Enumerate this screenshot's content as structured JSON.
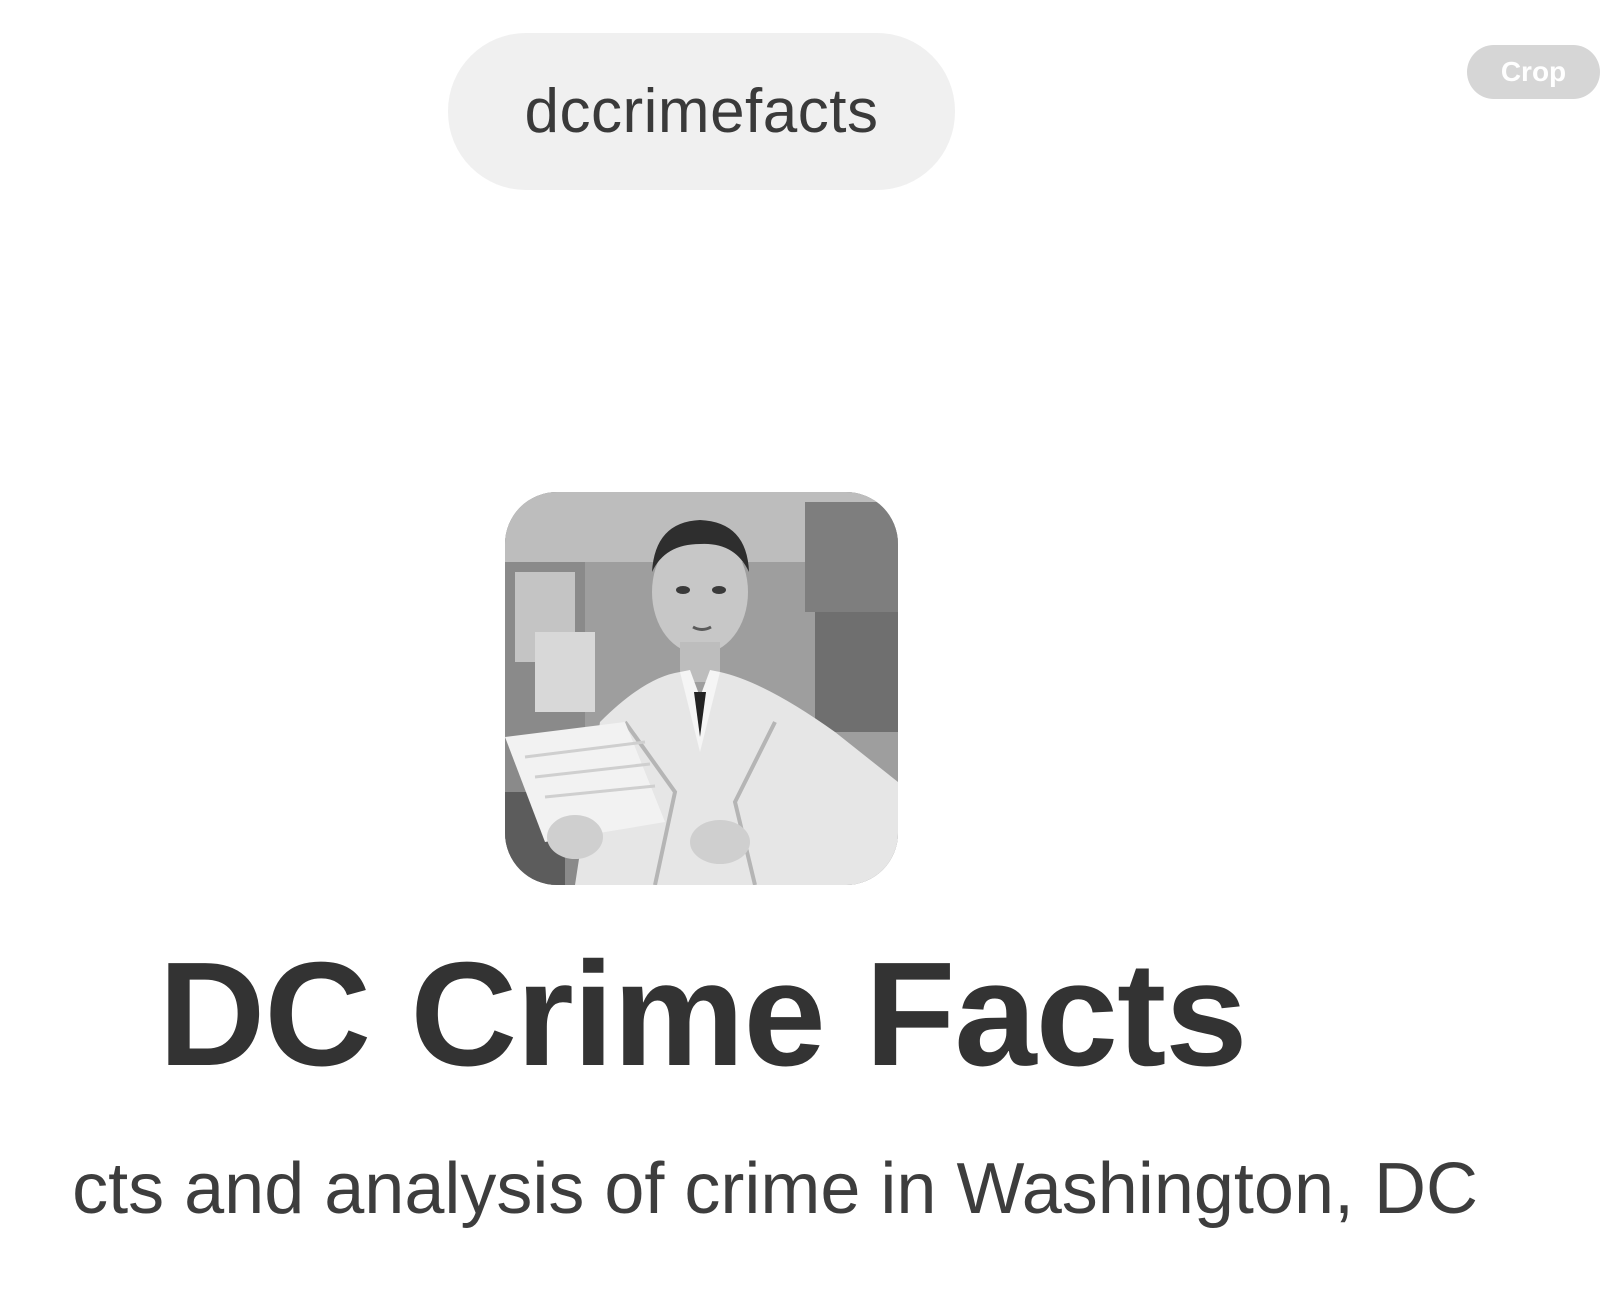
{
  "header": {
    "handle": "dccrimefacts",
    "crop_label": "Crop"
  },
  "publication": {
    "avatar_icon": "profile-photo-man-in-trench-coat",
    "title": "DC Crime Facts",
    "description": "cts and analysis of crime in Washington, DC"
  }
}
